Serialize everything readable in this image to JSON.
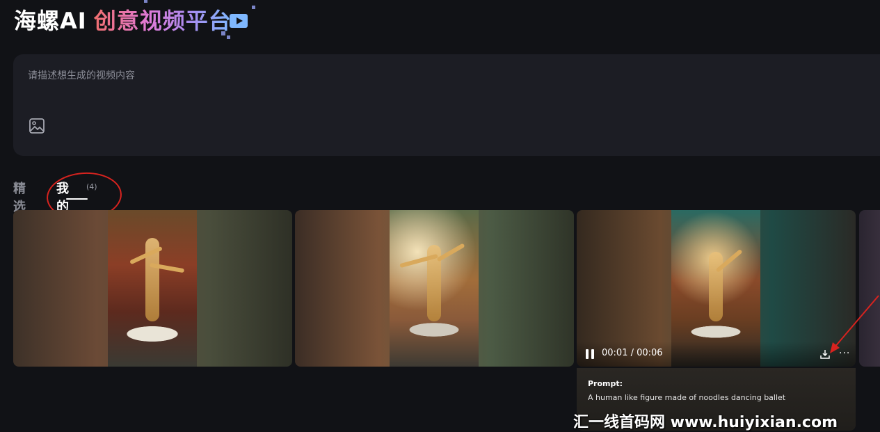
{
  "header": {
    "logo_main": "海螺AI",
    "logo_sub": "创意视频平台"
  },
  "prompt_input": {
    "placeholder": "请描述想生成的视频内容",
    "image_icon": "image-icon"
  },
  "tabs": [
    {
      "label": "精选",
      "active": false
    },
    {
      "label": "我的",
      "active": true,
      "count": "(4)"
    }
  ],
  "videos": [
    {
      "id": "video-1"
    },
    {
      "id": "video-2"
    },
    {
      "id": "video-3",
      "playing": true,
      "time": "00:01 / 00:06",
      "more": "···",
      "prompt_label": "Prompt:",
      "prompt_text": "A human like figure made of noodles dancing ballet"
    },
    {
      "id": "video-4"
    }
  ],
  "watermark": "汇一线首码网 www.huiyixian.com",
  "colors": {
    "background": "#111216",
    "panel": "#1c1d24",
    "annotation_red": "#d8231f"
  }
}
